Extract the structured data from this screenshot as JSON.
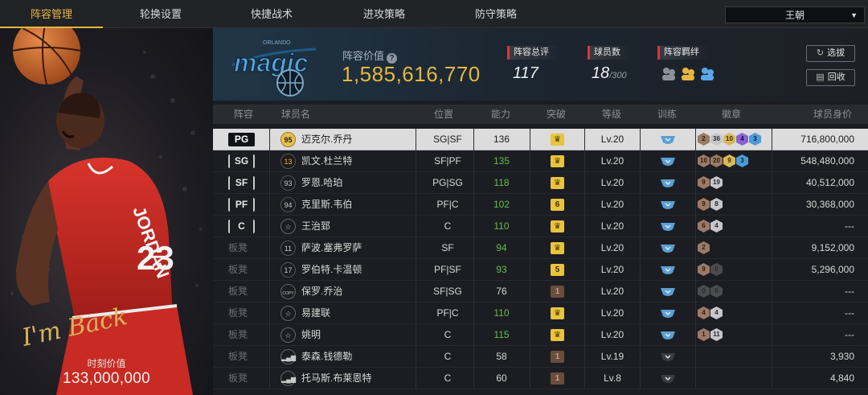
{
  "nav": {
    "tabs": [
      "阵容管理",
      "轮换设置",
      "快捷战术",
      "进攻策略",
      "防守策略"
    ],
    "active": 0,
    "team": "王朝"
  },
  "left": {
    "value_label": "时刻价值",
    "value": "133,000,000",
    "signature": "I'm Back",
    "jersey": "JORDAN 23"
  },
  "header": {
    "lineup_value_label": "阵容价值",
    "lineup_value": "1,585,616,770",
    "rating_label": "阵容总评",
    "rating": "117",
    "players_label": "球员数",
    "players": "18",
    "players_max": "/300",
    "bond_label": "阵容羁绊",
    "btn_select": "选拔",
    "btn_recycle": "回收"
  },
  "columns": {
    "lineup": "阵容",
    "name": "球员名",
    "position": "位置",
    "ability": "能力",
    "breakthrough": "突破",
    "level": "等级",
    "training": "训练",
    "badges": "徽章",
    "value": "球员身价"
  },
  "rows": [
    {
      "slot": "PG",
      "ovr": "95",
      "name": "迈克尔.乔丹",
      "pos": "SG|SF",
      "ability": "136",
      "brk": "crown",
      "level": "Lv.20",
      "badges": [
        [
          "bronze",
          "2"
        ],
        [
          "silver",
          "36"
        ],
        [
          "gold",
          "10"
        ],
        [
          "purple",
          "4"
        ],
        [
          "blue",
          "3"
        ]
      ],
      "value": "716,800,000",
      "selected": true
    },
    {
      "slot": "SG",
      "ovr": "13",
      "name": "凯文.杜兰特",
      "pos": "SF|PF",
      "ability": "135",
      "brk": "crown",
      "level": "Lv.20",
      "badges": [
        [
          "bronze",
          "10"
        ],
        [
          "bronze",
          "20"
        ],
        [
          "gold",
          "9"
        ],
        [
          "blue",
          "3"
        ]
      ],
      "value": "548,480,000"
    },
    {
      "slot": "SF",
      "ovr": "93",
      "name": "罗恩.哈珀",
      "pos": "PG|SG",
      "ability": "118",
      "brk": "crown",
      "level": "Lv.20",
      "badges": [
        [
          "bronze",
          "9"
        ],
        [
          "silver",
          "19"
        ]
      ],
      "value": "40,512,000"
    },
    {
      "slot": "PF",
      "ovr": "94",
      "name": "克里斯.韦伯",
      "pos": "PF|C",
      "ability": "102",
      "brk": "6",
      "level": "Lv.20",
      "badges": [
        [
          "bronze",
          "9"
        ],
        [
          "silver",
          "8"
        ]
      ],
      "value": "30,368,000"
    },
    {
      "slot": "C",
      "ovr": "star",
      "name": "王治郅",
      "pos": "C",
      "ability": "110",
      "brk": "crown",
      "level": "Lv.20",
      "badges": [
        [
          "bronze",
          "6"
        ],
        [
          "silver",
          "4"
        ]
      ],
      "value": "---"
    },
    {
      "slot": "板凳",
      "ovr": "11",
      "name": "萨波.塞弗罗萨",
      "pos": "SF",
      "ability": "94",
      "brk": "crown",
      "level": "Lv.20",
      "badges": [
        [
          "bronze",
          "2"
        ]
      ],
      "value": "9,152,000"
    },
    {
      "slot": "板凳",
      "ovr": "17",
      "name": "罗伯特.卡温顿",
      "pos": "PF|SF",
      "ability": "93",
      "brk": "5",
      "level": "Lv.20",
      "badges": [
        [
          "bronze",
          "9"
        ],
        [
          "dim",
          "0"
        ]
      ],
      "value": "5,296,000"
    },
    {
      "slot": "板凳",
      "ovr": "copy",
      "name": "保罗.乔治",
      "pos": "SF|SG",
      "ability": "76",
      "brk": "1b",
      "level": "Lv.20",
      "badges": [
        [
          "dim",
          "0"
        ],
        [
          "dim",
          "0"
        ]
      ],
      "value": "---"
    },
    {
      "slot": "板凳",
      "ovr": "star",
      "name": "易建联",
      "pos": "PF|C",
      "ability": "110",
      "brk": "crown",
      "level": "Lv.20",
      "badges": [
        [
          "bronze",
          "4"
        ],
        [
          "silver",
          "4"
        ]
      ],
      "value": "---"
    },
    {
      "slot": "板凳",
      "ovr": "star",
      "name": "姚明",
      "pos": "C",
      "ability": "115",
      "brk": "crown",
      "level": "Lv.20",
      "badges": [
        [
          "bronze",
          "1"
        ],
        [
          "silver",
          "11"
        ]
      ],
      "value": "---"
    },
    {
      "slot": "板凳",
      "ovr": "bars",
      "name": "泰森.钱德勒",
      "pos": "C",
      "ability": "58",
      "brk": "1b",
      "level": "Lv.19",
      "badges": [],
      "value": "3,930"
    },
    {
      "slot": "板凳",
      "ovr": "bars",
      "name": "托马斯.布莱恩特",
      "pos": "C",
      "ability": "60",
      "brk": "1b",
      "level": "Lv.8",
      "badges": [],
      "value": "4,840"
    }
  ],
  "colors": {
    "accent": "#e7b640",
    "green": "#5fbf4a",
    "red": "#d13a3a"
  }
}
